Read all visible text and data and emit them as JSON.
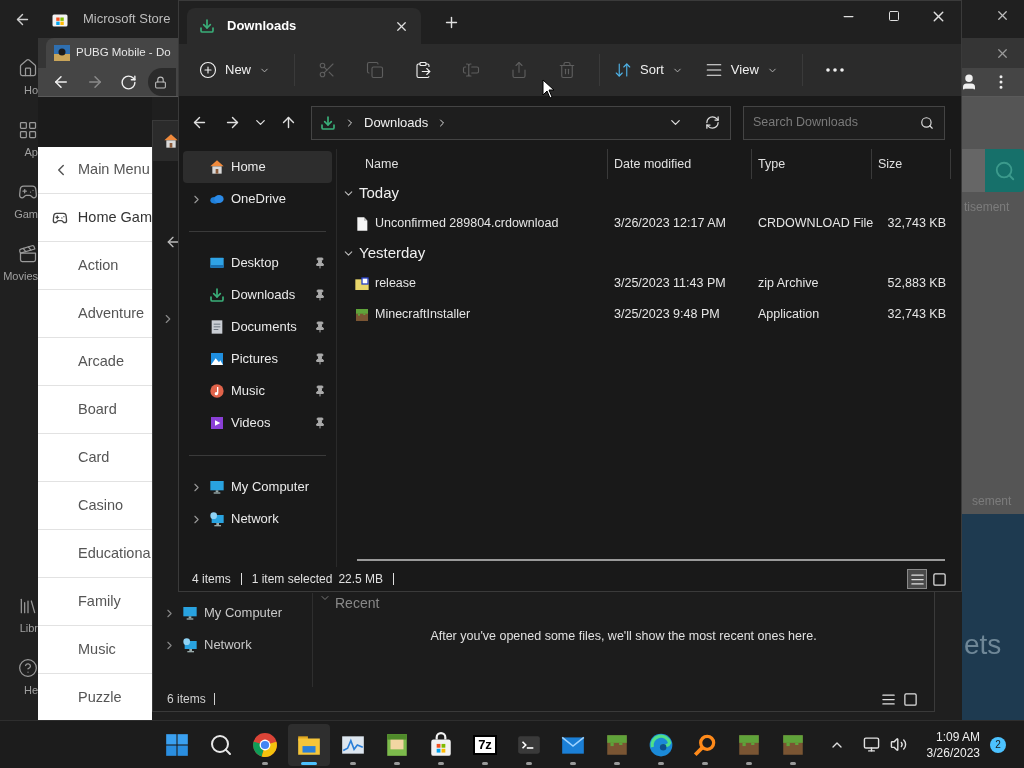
{
  "store": {
    "title": "Microsoft Store",
    "nav": [
      {
        "label": "Ho",
        "kind": "home"
      },
      {
        "label": "Ap",
        "kind": "apps"
      },
      {
        "label": "Gam",
        "kind": "gaming"
      },
      {
        "label": "Movies",
        "kind": "movies"
      },
      {
        "label": "Libr",
        "kind": "library"
      },
      {
        "label": "He",
        "kind": "help"
      }
    ]
  },
  "browser": {
    "tab_title": "PUBG Mobile - Do",
    "back_disabled": false,
    "forward_disabled": true,
    "menu": {
      "back_label": "Main Menu",
      "section": "Home Gam",
      "items": [
        "Action",
        "Adventure",
        "Arcade",
        "Board",
        "Card",
        "Casino",
        "Educationa",
        "Family",
        "Music",
        "Puzzle"
      ]
    },
    "page": {
      "text_1": "tisement",
      "text_2": "sement",
      "text_3": "ets"
    }
  },
  "explorer_behind": {
    "sidebar": [
      {
        "label": "My Computer",
        "kind": "computer"
      },
      {
        "label": "Network",
        "kind": "network"
      }
    ],
    "section": "Recent",
    "empty_message": "After you've opened some files, we'll show the most recent ones here.",
    "status": "6 items",
    "views": [
      {
        "kind": "details",
        "selected": false
      },
      {
        "kind": "tiles",
        "selected": false
      }
    ]
  },
  "explorer": {
    "tab": "Downloads",
    "toolbar": [
      {
        "kind": "new",
        "label": "New",
        "disabled": false
      },
      {
        "kind": "cut",
        "disabled": true
      },
      {
        "kind": "copy",
        "disabled": true
      },
      {
        "kind": "paste",
        "disabled": false
      },
      {
        "kind": "rename",
        "disabled": true
      },
      {
        "kind": "share",
        "disabled": true
      },
      {
        "kind": "delete",
        "disabled": true
      },
      {
        "kind": "sort",
        "label": "Sort",
        "disabled": false
      },
      {
        "kind": "view",
        "label": "View",
        "disabled": false
      },
      {
        "kind": "more",
        "disabled": false
      }
    ],
    "address": "Downloads",
    "search_placeholder": "Search Downloads",
    "sidebar": [
      [
        {
          "label": "Home",
          "kind": "home",
          "expandable": false,
          "pinned": false,
          "selected": true
        },
        {
          "label": "OneDrive",
          "kind": "cloud",
          "expandable": true,
          "pinned": false,
          "selected": false
        }
      ],
      [
        {
          "label": "Desktop",
          "kind": "desktop",
          "expandable": false,
          "pinned": true,
          "selected": false
        },
        {
          "label": "Downloads",
          "kind": "download",
          "expandable": false,
          "pinned": true,
          "selected": false
        },
        {
          "label": "Documents",
          "kind": "documents",
          "expandable": false,
          "pinned": true,
          "selected": false
        },
        {
          "label": "Pictures",
          "kind": "pictures",
          "expandable": false,
          "pinned": true,
          "selected": false
        },
        {
          "label": "Music",
          "kind": "music",
          "expandable": false,
          "pinned": true,
          "selected": false
        },
        {
          "label": "Videos",
          "kind": "videos",
          "expandable": false,
          "pinned": true,
          "selected": false
        }
      ],
      [
        {
          "label": "My Computer",
          "kind": "computer",
          "expandable": true,
          "pinned": false,
          "selected": false
        },
        {
          "label": "Network",
          "kind": "network",
          "expandable": true,
          "pinned": false,
          "selected": false
        }
      ]
    ],
    "columns": [
      "Name",
      "Date modified",
      "Type",
      "Size"
    ],
    "groups": [
      {
        "label": "Today",
        "expanded": true,
        "files": [
          {
            "kind": "blank",
            "name": "Unconfirmed 289804.crdownload",
            "date": "3/26/2023 12:17 AM",
            "type": "CRDOWNLOAD File",
            "size": "32,743 KB"
          }
        ]
      },
      {
        "label": "Yesterday",
        "expanded": true,
        "files": [
          {
            "kind": "zip",
            "name": "release",
            "date": "3/25/2023 11:43 PM",
            "type": "zip Archive",
            "size": "52,883 KB"
          },
          {
            "kind": "block",
            "name": "MinecraftInstaller",
            "date": "3/25/2023 9:48 PM",
            "type": "Application",
            "size": "32,743 KB"
          }
        ]
      }
    ],
    "status": {
      "items": "4 items",
      "selected": "1 item selected",
      "size": "22.5 MB"
    },
    "views": [
      {
        "kind": "details",
        "selected": true
      },
      {
        "kind": "tiles",
        "selected": false
      }
    ]
  },
  "taskbar": {
    "apps": [
      {
        "kind": "start",
        "running": false,
        "active": false
      },
      {
        "kind": "search",
        "running": false,
        "active": false
      },
      {
        "kind": "browser",
        "running": true,
        "active": false
      },
      {
        "kind": "folder",
        "running": true,
        "active": true
      },
      {
        "kind": "chart",
        "running": true,
        "active": false
      },
      {
        "kind": "character",
        "running": true,
        "active": false
      },
      {
        "kind": "store",
        "running": true,
        "active": false
      },
      {
        "kind": "archiver",
        "label": "7z",
        "running": true,
        "active": false
      },
      {
        "kind": "terminal",
        "running": true,
        "active": false
      },
      {
        "kind": "mail",
        "running": true,
        "active": false
      },
      {
        "kind": "block",
        "running": true,
        "active": false
      },
      {
        "kind": "swirl",
        "running": true,
        "active": false
      },
      {
        "kind": "magnifier",
        "running": true,
        "active": false
      },
      {
        "kind": "block",
        "running": true,
        "active": false
      },
      {
        "kind": "block",
        "running": true,
        "active": false
      }
    ],
    "time": "1:09 AM",
    "date": "3/26/2023",
    "notifications": "2"
  }
}
